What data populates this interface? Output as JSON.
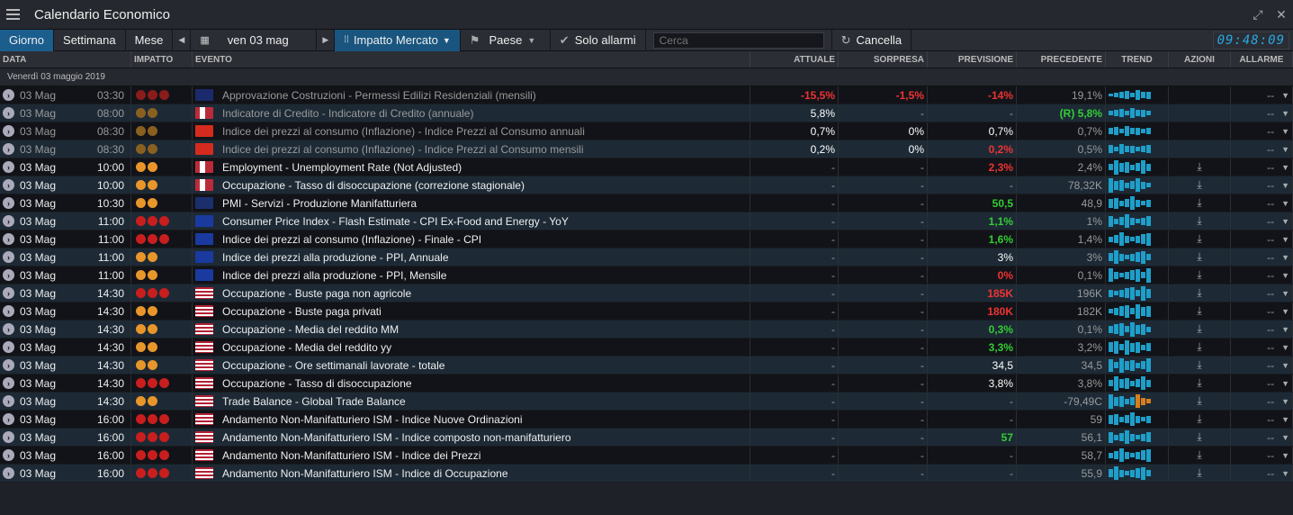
{
  "title": "Calendario Economico",
  "toolbar": {
    "giorno": "Giorno",
    "settimana": "Settimana",
    "mese": "Mese",
    "date": "ven 03 mag",
    "impatto": "Impatto Mercato",
    "paese": "Paese",
    "solo": "Solo allarmi",
    "search_placeholder": "Cerca",
    "cancella": "Cancella",
    "clock": "09:48:09"
  },
  "headers": {
    "data": "DATA",
    "impatto": "IMPATTO",
    "evento": "EVENTO",
    "attuale": "ATTUALE",
    "sorpresa": "SORPRESA",
    "previsione": "PREVISIONE",
    "precedente": "PRECEDENTE",
    "trend": "TREND",
    "azioni": "AZIONI",
    "allarme": "ALLARME"
  },
  "group_label": "Venerdì 03 maggio 2019",
  "colors": {
    "red": "#c81e1e",
    "orange": "#e8962a",
    "faded_red": "#8a1c1c",
    "faded_orange": "#8a6020"
  },
  "rows": [
    {
      "date": "03 Mag",
      "time": "03:30",
      "impact": [
        "r",
        "r",
        "r"
      ],
      "faded": true,
      "flag": "au",
      "event": "Approvazione Costruzioni - Permessi Edilizi Residenziali (mensili)",
      "actual": "-15,5%",
      "a_cls": "red",
      "surprise": "-1,5%",
      "s_cls": "red",
      "forecast": "-14%",
      "f_cls": "red",
      "previous": "19,1%",
      "alarm": "--"
    },
    {
      "date": "03 Mag",
      "time": "08:00",
      "impact": [
        "o",
        "o"
      ],
      "faded": true,
      "flag": "no",
      "event": "Indicatore di Credito - Indicatore di Credito (annuale)",
      "actual": "5,8%",
      "a_cls": "wht",
      "surprise": "-",
      "s_cls": "gry",
      "forecast": "-",
      "f_cls": "gry",
      "previous": "(R) 5,8%",
      "p_cls": "grn",
      "alarm": "--"
    },
    {
      "date": "03 Mag",
      "time": "08:30",
      "impact": [
        "o",
        "o"
      ],
      "faded": true,
      "flag": "ch",
      "event": "Indice dei prezzi al consumo (Inflazione) - Indice Prezzi al Consumo annuali",
      "actual": "0,7%",
      "a_cls": "wht",
      "surprise": "0%",
      "s_cls": "wht",
      "forecast": "0,7%",
      "f_cls": "wht",
      "previous": "0,7%",
      "alarm": "--"
    },
    {
      "date": "03 Mag",
      "time": "08:30",
      "impact": [
        "o",
        "o"
      ],
      "faded": true,
      "flag": "ch",
      "event": "Indice dei prezzi al consumo (Inflazione) - Indice Prezzi al Consumo mensili",
      "actual": "0,2%",
      "a_cls": "wht",
      "surprise": "0%",
      "s_cls": "wht",
      "forecast": "0,2%",
      "f_cls": "red",
      "previous": "0,5%",
      "alarm": "--"
    },
    {
      "date": "03 Mag",
      "time": "10:00",
      "impact": [
        "o",
        "o"
      ],
      "flag": "no",
      "event": "Employment - Unemployment Rate (Not Adjusted)",
      "actual": "-",
      "surprise": "-",
      "forecast": "2,3%",
      "f_cls": "red",
      "previous": "2,4%",
      "alarm": "--",
      "dl": true
    },
    {
      "date": "03 Mag",
      "time": "10:00",
      "impact": [
        "o",
        "o"
      ],
      "flag": "no",
      "event": "Occupazione - Tasso di disoccupazione (correzione stagionale)",
      "actual": "-",
      "surprise": "-",
      "forecast": "-",
      "previous": "78,32K",
      "alarm": "--",
      "dl": true
    },
    {
      "date": "03 Mag",
      "time": "10:30",
      "impact": [
        "o",
        "o"
      ],
      "flag": "gb",
      "event": "PMI - Servizi - Produzione Manifatturiera",
      "actual": "-",
      "surprise": "-",
      "forecast": "50,5",
      "f_cls": "grn",
      "previous": "48,9",
      "alarm": "--",
      "dl": true
    },
    {
      "date": "03 Mag",
      "time": "11:00",
      "impact": [
        "r",
        "r",
        "r"
      ],
      "flag": "eu",
      "event": "Consumer Price Index - Flash Estimate - CPI Ex-Food and Energy - YoY",
      "actual": "-",
      "surprise": "-",
      "forecast": "1,1%",
      "f_cls": "grn",
      "previous": "1%",
      "alarm": "--",
      "dl": true
    },
    {
      "date": "03 Mag",
      "time": "11:00",
      "impact": [
        "r",
        "r",
        "r"
      ],
      "flag": "eu",
      "event": "Indice dei prezzi al consumo (Inflazione) - Finale - CPI",
      "actual": "-",
      "surprise": "-",
      "forecast": "1,6%",
      "f_cls": "grn",
      "previous": "1,4%",
      "alarm": "--",
      "dl": true
    },
    {
      "date": "03 Mag",
      "time": "11:00",
      "impact": [
        "o",
        "o"
      ],
      "flag": "eu",
      "event": "Indice dei prezzi alla produzione - PPI, Annuale",
      "actual": "-",
      "surprise": "-",
      "forecast": "3%",
      "f_cls": "wht",
      "previous": "3%",
      "alarm": "--",
      "dl": true
    },
    {
      "date": "03 Mag",
      "time": "11:00",
      "impact": [
        "o",
        "o"
      ],
      "flag": "eu",
      "event": "Indice dei prezzi alla produzione - PPI, Mensile",
      "actual": "-",
      "surprise": "-",
      "forecast": "0%",
      "f_cls": "red",
      "previous": "0,1%",
      "alarm": "--",
      "dl": true
    },
    {
      "date": "03 Mag",
      "time": "14:30",
      "impact": [
        "r",
        "r",
        "r"
      ],
      "flag": "us",
      "event": "Occupazione - Buste paga non agricole",
      "actual": "-",
      "surprise": "-",
      "forecast": "185K",
      "f_cls": "red",
      "previous": "196K",
      "alarm": "--",
      "dl": true
    },
    {
      "date": "03 Mag",
      "time": "14:30",
      "impact": [
        "o",
        "o"
      ],
      "flag": "us",
      "event": "Occupazione - Buste paga privati",
      "actual": "-",
      "surprise": "-",
      "forecast": "180K",
      "f_cls": "red",
      "previous": "182K",
      "alarm": "--",
      "dl": true
    },
    {
      "date": "03 Mag",
      "time": "14:30",
      "impact": [
        "o",
        "o"
      ],
      "flag": "us",
      "event": "Occupazione - Media del reddito MM",
      "actual": "-",
      "surprise": "-",
      "forecast": "0,3%",
      "f_cls": "grn",
      "previous": "0,1%",
      "alarm": "--",
      "dl": true
    },
    {
      "date": "03 Mag",
      "time": "14:30",
      "impact": [
        "o",
        "o"
      ],
      "flag": "us",
      "event": "Occupazione - Media del reddito yy",
      "actual": "-",
      "surprise": "-",
      "forecast": "3,3%",
      "f_cls": "grn",
      "previous": "3,2%",
      "alarm": "--",
      "dl": true
    },
    {
      "date": "03 Mag",
      "time": "14:30",
      "impact": [
        "o",
        "o"
      ],
      "flag": "us",
      "event": "Occupazione - Ore settimanali lavorate - totale",
      "actual": "-",
      "surprise": "-",
      "forecast": "34,5",
      "f_cls": "wht",
      "previous": "34,5",
      "alarm": "--",
      "dl": true
    },
    {
      "date": "03 Mag",
      "time": "14:30",
      "impact": [
        "r",
        "r",
        "r"
      ],
      "flag": "us",
      "event": "Occupazione - Tasso di disoccupazione",
      "actual": "-",
      "surprise": "-",
      "forecast": "3,8%",
      "f_cls": "wht",
      "previous": "3,8%",
      "alarm": "--",
      "dl": true
    },
    {
      "date": "03 Mag",
      "time": "14:30",
      "impact": [
        "o",
        "o"
      ],
      "flag": "us",
      "event": "Trade Balance - Global Trade Balance",
      "actual": "-",
      "surprise": "-",
      "forecast": "-",
      "previous": "-79,49C",
      "alarm": "--",
      "dl": true,
      "neg": true
    },
    {
      "date": "03 Mag",
      "time": "16:00",
      "impact": [
        "r",
        "r",
        "r"
      ],
      "flag": "us",
      "event": "Andamento Non-Manifatturiero ISM - Indice Nuove Ordinazioni",
      "actual": "-",
      "surprise": "-",
      "forecast": "-",
      "previous": "59",
      "alarm": "--",
      "dl": true
    },
    {
      "date": "03 Mag",
      "time": "16:00",
      "impact": [
        "r",
        "r",
        "r"
      ],
      "flag": "us",
      "event": "Andamento Non-Manifatturiero ISM - Indice composto non-manifatturiero",
      "actual": "-",
      "surprise": "-",
      "forecast": "57",
      "f_cls": "grn",
      "previous": "56,1",
      "alarm": "--",
      "dl": true
    },
    {
      "date": "03 Mag",
      "time": "16:00",
      "impact": [
        "r",
        "r",
        "r"
      ],
      "flag": "us",
      "event": "Andamento Non-Manifatturiero ISM - Indice dei Prezzi",
      "actual": "-",
      "surprise": "-",
      "forecast": "-",
      "previous": "58,7",
      "alarm": "--",
      "dl": true
    },
    {
      "date": "03 Mag",
      "time": "16:00",
      "impact": [
        "r",
        "r",
        "r"
      ],
      "flag": "us",
      "event": "Andamento Non-Manifatturiero ISM - Indice di Occupazione",
      "actual": "-",
      "surprise": "-",
      "forecast": "-",
      "previous": "55,9",
      "alarm": "--",
      "dl": true
    }
  ]
}
